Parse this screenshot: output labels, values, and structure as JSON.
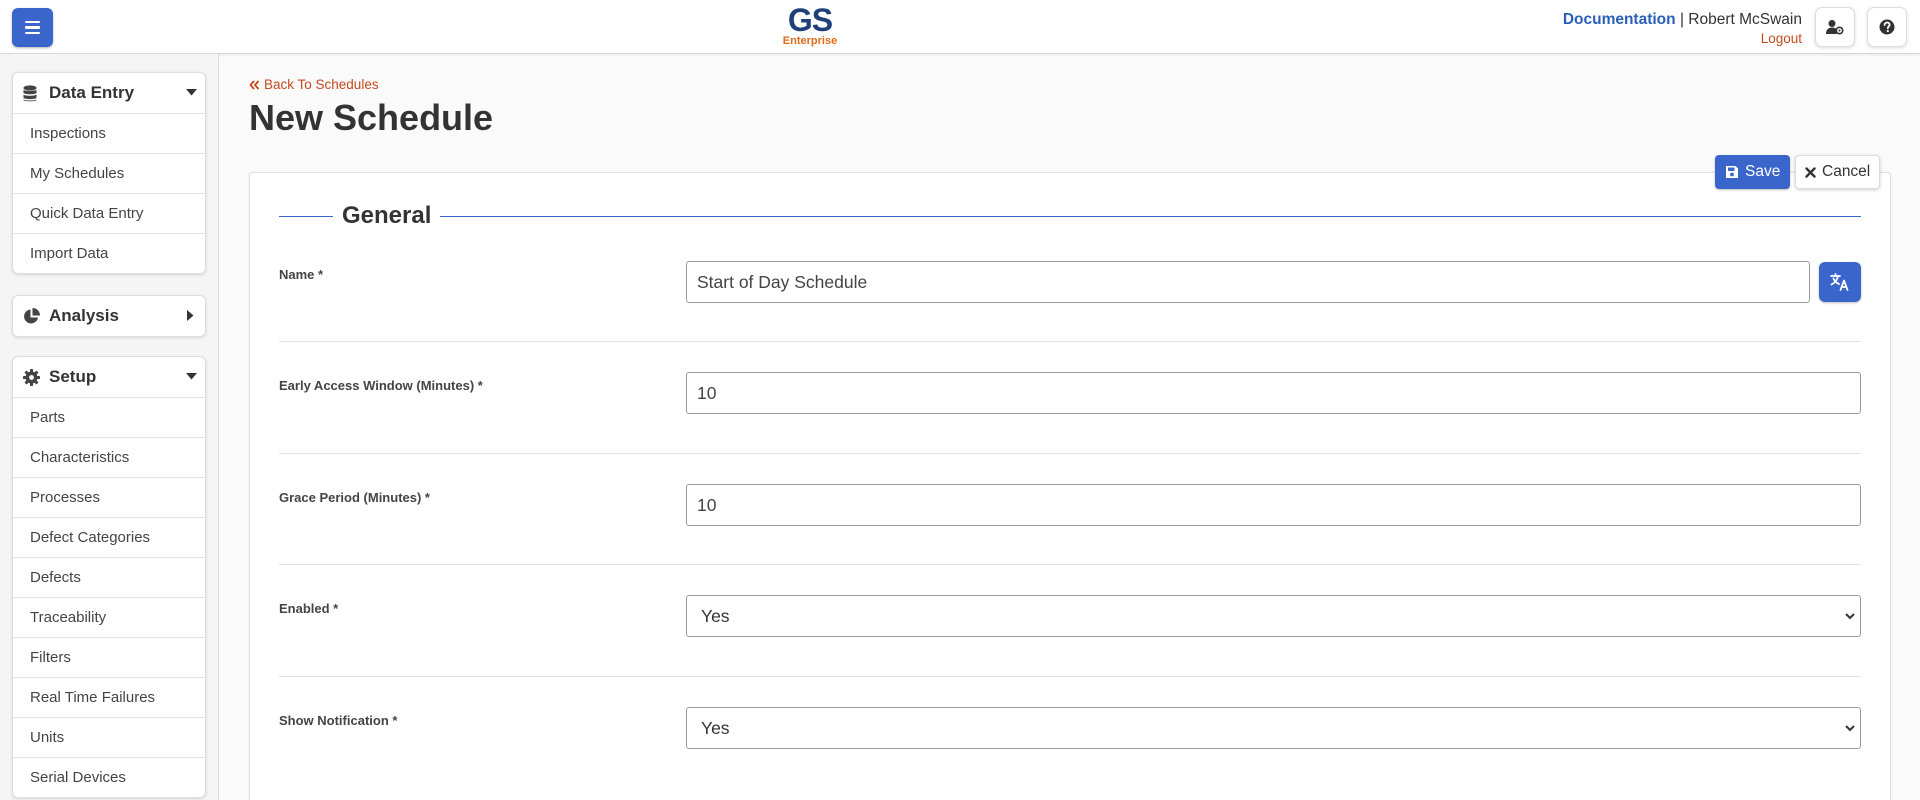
{
  "header": {
    "logo_main": "GS",
    "logo_sub": "Enterprise",
    "documentation_label": "Documentation",
    "separator": "|",
    "user_name": "Robert McSwain",
    "logout_label": "Logout",
    "icons": [
      "menu-icon",
      "user-settings-icon",
      "help-icon"
    ]
  },
  "sidebar": {
    "data_entry": {
      "title": "Data Entry",
      "items": [
        "Inspections",
        "My Schedules",
        "Quick Data Entry",
        "Import Data"
      ]
    },
    "analysis": {
      "title": "Analysis"
    },
    "setup": {
      "title": "Setup",
      "items": [
        "Parts",
        "Characteristics",
        "Processes",
        "Defect Categories",
        "Defects",
        "Traceability",
        "Filters",
        "Real Time Failures",
        "Units",
        "Serial Devices"
      ]
    }
  },
  "main": {
    "back_label": "Back To Schedules",
    "title": "New Schedule",
    "save_label": "Save",
    "cancel_label": "Cancel",
    "section_title": "General",
    "fields": {
      "name": {
        "label": "Name *",
        "value": "Start of Day Schedule"
      },
      "early_access": {
        "label": "Early Access Window (Minutes) *",
        "value": "10"
      },
      "grace_period": {
        "label": "Grace Period (Minutes) *",
        "value": "10"
      },
      "enabled": {
        "label": "Enabled *",
        "value": "Yes"
      },
      "show_notification": {
        "label": "Show Notification *",
        "value": "Yes"
      }
    }
  },
  "colors": {
    "primary": "#3a66cc",
    "accent": "#c44a1e",
    "logo_blue": "#1f3f7a",
    "logo_orange": "#e06a1a"
  }
}
